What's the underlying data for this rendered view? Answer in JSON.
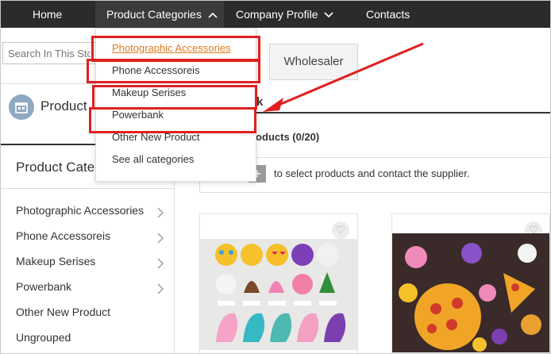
{
  "nav": {
    "home": "Home",
    "categories": "Product Categories",
    "company": "Company Profile",
    "contacts": "Contacts"
  },
  "search": {
    "placeholder": "Search In This Sto"
  },
  "dropdown": {
    "items": [
      "Photographic Accessories",
      "Phone Accessoreis",
      "Makeup Serises",
      "Powerbank",
      "Other New Product",
      "See all categories"
    ]
  },
  "sidebar": {
    "products_heading": "Product",
    "categories_heading": "Product Cate",
    "items": [
      {
        "label": "Photographic Accessories"
      },
      {
        "label": "Phone Accessoreis"
      },
      {
        "label": "Makeup Serises"
      },
      {
        "label": "Powerbank"
      },
      {
        "label": "Other New Product"
      },
      {
        "label": "Ungrouped"
      }
    ]
  },
  "main": {
    "wholesaler": "Wholesaler",
    "section_suffix": "k",
    "compare_title": "roducts (0/20)",
    "select_hint": "to select products and contact the supplier."
  },
  "colors": {
    "nav_bg": "#2b2b2b",
    "highlight_box": "#e02020",
    "link_active": "#e07a1f"
  }
}
